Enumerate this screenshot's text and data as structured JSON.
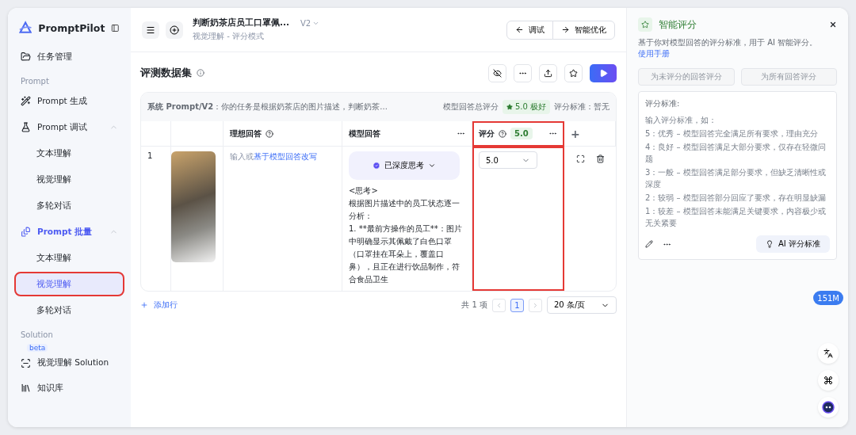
{
  "sidebar": {
    "brand": "PromptPilot",
    "sections": [
      {
        "items": [
          {
            "kind": "top",
            "label": "任务管理",
            "selected": false
          }
        ]
      },
      {
        "heading": "Prompt",
        "items": [
          {
            "kind": "top",
            "label": "Prompt 生成",
            "selected": false
          },
          {
            "kind": "group",
            "label": "Prompt 调试",
            "selected": false,
            "expanded": true,
            "children": [
              {
                "label": "文本理解",
                "selected": false,
                "highlighted": false
              },
              {
                "label": "视觉理解",
                "selected": false,
                "highlighted": false
              },
              {
                "label": "多轮对话",
                "selected": false,
                "highlighted": false
              }
            ]
          },
          {
            "kind": "group",
            "label": "Prompt 批量",
            "selected": true,
            "expanded": true,
            "children": [
              {
                "label": "文本理解",
                "selected": false,
                "highlighted": false
              },
              {
                "label": "视觉理解",
                "selected": true,
                "highlighted": true
              },
              {
                "label": "多轮对话",
                "selected": false,
                "highlighted": false
              }
            ]
          }
        ]
      },
      {
        "heading": "Solution",
        "items": [
          {
            "kind": "top",
            "label": "视觉理解 Solution",
            "badge": "beta",
            "selected": false
          },
          {
            "kind": "top",
            "label": "知识库",
            "selected": false
          }
        ]
      }
    ]
  },
  "header": {
    "title": "判断奶茶店员工口罩佩...",
    "version": "V2",
    "subtitle": "视觉理解 - 评分模式",
    "buttons": [
      {
        "label": "调试"
      },
      {
        "label": "智能优化"
      }
    ]
  },
  "dataset": {
    "title": "评测数据集",
    "summary": {
      "prompt_label": "系统 Prompt/V2",
      "prompt_text": "：你的任务是根据奶茶店的图片描述，判断奶茶...",
      "score_label": "模型回答总评分",
      "score": "5.0 极好",
      "standard": "评分标准：暂无"
    },
    "columns": [
      {
        "kind": "index"
      },
      {
        "kind": "image"
      },
      {
        "kind": "ideal",
        "label": "理想回答",
        "help": true
      },
      {
        "kind": "model",
        "label": "模型回答",
        "more": true
      },
      {
        "kind": "score",
        "label": "评分",
        "help": true,
        "badge": "5.0",
        "more": true,
        "highlighted": true
      },
      {
        "kind": "add",
        "label": "+"
      }
    ],
    "rows": [
      {
        "index": "1",
        "ideal_hint": "输入或",
        "ideal_link": "基于模型回答改写",
        "thinking": "已深度思考",
        "model_text": "<思考>\n根据图片描述中的员工状态逐一分析：\n1. **最前方操作的员工**：图片中明确显示其佩戴了白色口罩（口罩挂在耳朵上，覆盖口鼻），且正在进行饮品制作，符合食品卫生",
        "score": "5.0"
      }
    ],
    "add_row": "添加行",
    "pagination": {
      "total": "共 1 项",
      "pages": [
        {
          "label": "1",
          "selected": true
        }
      ],
      "page_size": "20 条/页"
    }
  },
  "panel": {
    "title": "智能评分",
    "description": "基于你对模型回答的评分标准，用于 AI 智能评分。",
    "link": "使用手册",
    "buttons": [
      {
        "label": "为未评分的回答评分",
        "disabled": true
      },
      {
        "label": "为所有回答评分",
        "disabled": true
      }
    ],
    "criteria_label": "评分标准:",
    "criteria_lines": [
      "输入评分标准，如：",
      "5：优秀 – 模型回答完全满足所有要求，理由充分",
      "4：良好 – 模型回答满足大部分要求，仅存在轻微问题",
      "3：一般 – 模型回答满足部分要求，但缺乏清晰性或深度",
      "2：较弱 – 模型回答部分回应了要求，存在明显缺漏",
      "1：较差 – 模型回答未能满足关键要求，内容极少或无关紧要"
    ],
    "ai_button": "AI 评分标准"
  },
  "floating": {
    "memory": "151M"
  }
}
